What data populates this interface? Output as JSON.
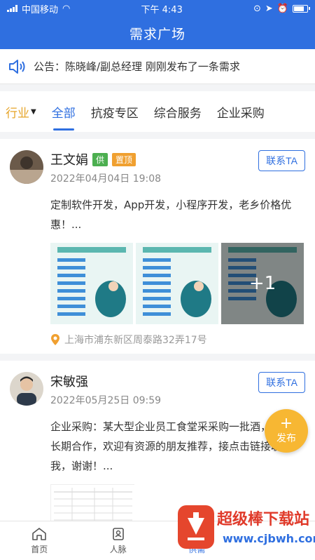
{
  "status_bar": {
    "carrier": "中国移动",
    "time": "下午 4:43"
  },
  "header": {
    "title": "需求广场"
  },
  "notice": {
    "text": "公告：陈晓峰/副总经理 刚刚发布了一条需求"
  },
  "tabs": {
    "filter_label": "行业",
    "items": [
      "全部",
      "抗疫专区",
      "综合服务",
      "企业采购"
    ],
    "active_index": 0
  },
  "posts": [
    {
      "author": "王文娟",
      "badges": [
        "供",
        "置顶"
      ],
      "time": "2022年04月04日 19:08",
      "contact_label": "联系TA",
      "content": "定制软件开发，App开发，小程序开发，老乡价格优惠！...",
      "images_more": "+1",
      "location": "上海市浦东新区周泰路32弄17号"
    },
    {
      "author": "宋敏强",
      "time": "2022年05月25日 09:59",
      "contact_label": "联系TA",
      "content": "企业采购：某大型企业员工食堂采采购一批酒，后期可长期合作，欢迎有资源的朋友推荐，接点击链接联系我，谢谢！..."
    }
  ],
  "fab": {
    "plus": "+",
    "label": "发布"
  },
  "bottom_nav": {
    "items": [
      "首页",
      "人脉",
      "供需"
    ],
    "active_index": 2
  },
  "watermark": {
    "brand": "超级棒下载站",
    "url": "www.cjbwh.com"
  },
  "colors": {
    "primary": "#2f6fe0",
    "accent": "#f7b733",
    "badge_supply": "#4caf50",
    "badge_top": "#f0a030"
  }
}
